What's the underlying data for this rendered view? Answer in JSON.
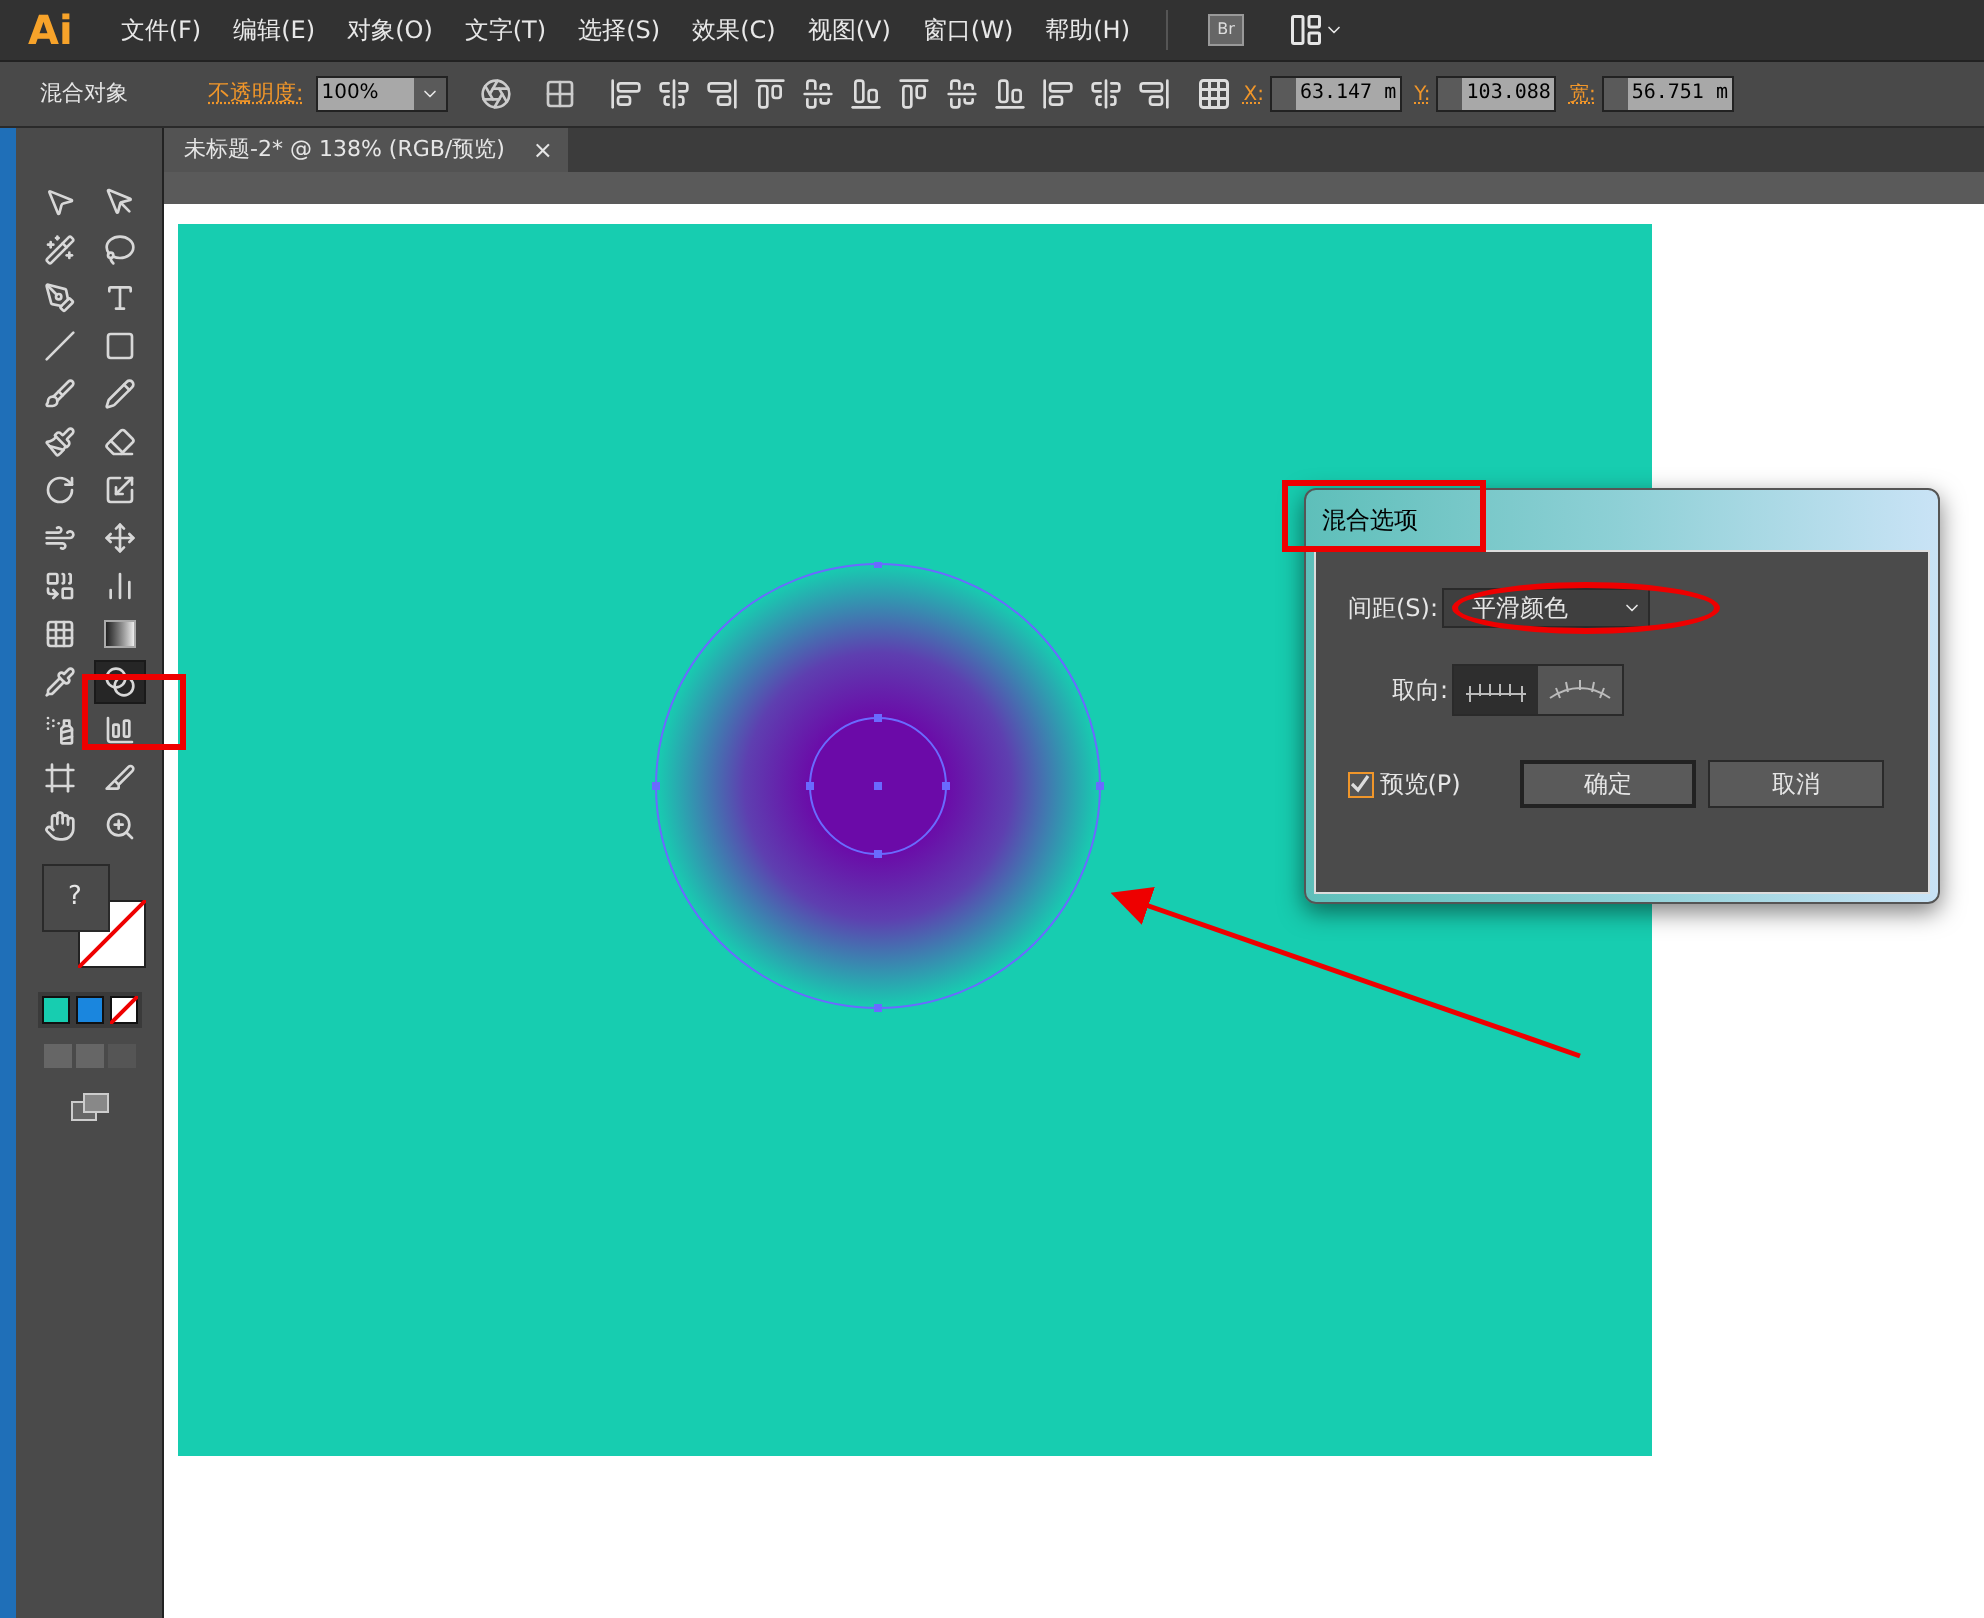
{
  "app_logo": "Ai",
  "menu": [
    "文件(F)",
    "编辑(E)",
    "对象(O)",
    "文字(T)",
    "选择(S)",
    "效果(C)",
    "视图(V)",
    "窗口(W)",
    "帮助(H)"
  ],
  "bridge_button": "Br",
  "control_bar": {
    "selection_label": "混合对象",
    "opacity_label": "不透明度:",
    "opacity_value": "100%",
    "coords": [
      {
        "label": "X:",
        "value": "63.147 m"
      },
      {
        "label": "Y:",
        "value": "103.088"
      },
      {
        "label": "宽:",
        "value": "56.751 m"
      }
    ]
  },
  "document_tab": {
    "title": "未标题-2* @ 138% (RGB/预览)",
    "close": "×"
  },
  "tools": [
    {
      "kind": "selection",
      "selected": false
    },
    {
      "kind": "direct-selection",
      "selected": false
    },
    {
      "kind": "magic-wand",
      "selected": false
    },
    {
      "kind": "lasso",
      "selected": false
    },
    {
      "kind": "pen",
      "selected": false
    },
    {
      "kind": "type",
      "selected": false
    },
    {
      "kind": "line",
      "selected": false
    },
    {
      "kind": "rectangle",
      "selected": false
    },
    {
      "kind": "brush",
      "selected": false
    },
    {
      "kind": "pencil",
      "selected": false
    },
    {
      "kind": "blob-brush",
      "selected": false
    },
    {
      "kind": "eraser",
      "selected": false
    },
    {
      "kind": "rotate",
      "selected": false
    },
    {
      "kind": "scale",
      "selected": false
    },
    {
      "kind": "warp",
      "selected": false
    },
    {
      "kind": "free-transform",
      "selected": false
    },
    {
      "kind": "shape-builder",
      "selected": false
    },
    {
      "kind": "perspective",
      "selected": false
    },
    {
      "kind": "mesh",
      "selected": false
    },
    {
      "kind": "gradient",
      "selected": false
    },
    {
      "kind": "eyedropper",
      "selected": false
    },
    {
      "kind": "blend",
      "selected": true
    },
    {
      "kind": "sprayer",
      "selected": false
    },
    {
      "kind": "graph",
      "selected": false
    },
    {
      "kind": "artboard",
      "selected": false
    },
    {
      "kind": "slice",
      "selected": false
    },
    {
      "kind": "hand",
      "selected": false
    },
    {
      "kind": "zoom",
      "selected": false
    }
  ],
  "fill_stroke": {
    "fill_text": "?"
  },
  "color_modes": [
    {
      "kind": "color",
      "color": "#17cdb0"
    },
    {
      "kind": "color",
      "color": "#1a86de"
    },
    {
      "kind": "none"
    }
  ],
  "dialog": {
    "title": "混合选项",
    "spacing_label": "间距(S):",
    "spacing_value": "平滑颜色",
    "orientation_label": "取向:",
    "orientations": [
      {
        "kind": "page",
        "selected": true
      },
      {
        "kind": "path",
        "selected": false
      }
    ],
    "preview": {
      "label": "预览(P)",
      "checked": true
    },
    "buttons": [
      {
        "label": "确定",
        "default": true
      },
      {
        "label": "取消",
        "default": false
      }
    ]
  }
}
